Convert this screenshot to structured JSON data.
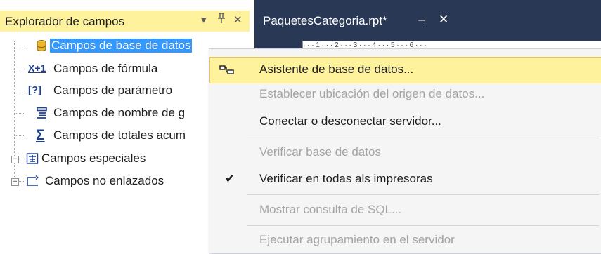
{
  "panel": {
    "title": "Explorador de campos",
    "dropdown_glyph": "▾",
    "pin_glyph": "ᵖ",
    "close_glyph": "✕",
    "items": [
      {
        "label": "Campos de base de datos",
        "icon": "database-icon",
        "selected": true
      },
      {
        "label": "Campos de fórmula",
        "icon": "formula-icon"
      },
      {
        "label": "Campos de parámetro",
        "icon": "parameter-icon"
      },
      {
        "label": "Campos de nombre de g",
        "icon": "group-name-icon"
      },
      {
        "label": "Campos de totales acum",
        "icon": "sum-icon"
      },
      {
        "label": "Campos especiales",
        "icon": "special-fields-icon",
        "expandable": true
      },
      {
        "label": "Campos no enlazados",
        "icon": "unbound-fields-icon",
        "expandable": true
      }
    ],
    "formula_icon_text": "X+1",
    "parameter_icon_text": "[?]",
    "sum_icon_text": "Σ",
    "expander_glyph": "+"
  },
  "document": {
    "tab_label": "PaquetesCategoria.rpt*",
    "pin_glyph": "⊣",
    "close_glyph": "✕",
    "ruler_text": "· · · 1 · · · 2 · · · 3 · · · 4 · · · 5 · · · 6 · · ·"
  },
  "menu": {
    "items": [
      {
        "label": "Asistente de base de datos...",
        "enabled": true,
        "hover": true,
        "icon": "database-expert-icon"
      },
      {
        "label": "Establecer ubicación del origen de datos...",
        "enabled": false
      },
      {
        "label": "Conectar o desconectar servidor...",
        "enabled": true
      },
      {
        "label": "Verificar base de datos",
        "enabled": false
      },
      {
        "label": "Verificar en todas als impresoras",
        "enabled": true,
        "checked": true
      },
      {
        "label": "Mostrar consulta de SQL...",
        "enabled": false
      },
      {
        "label": "Ejecutar agrupamiento en el servidor",
        "enabled": false
      }
    ],
    "check_glyph": "✔"
  },
  "colors": {
    "header_yellow": "#fff29d",
    "selection_blue": "#3399ff",
    "tab_dark": "#293955",
    "menu_bg": "#f5f5f5",
    "disabled_text": "#a2a4a5"
  }
}
